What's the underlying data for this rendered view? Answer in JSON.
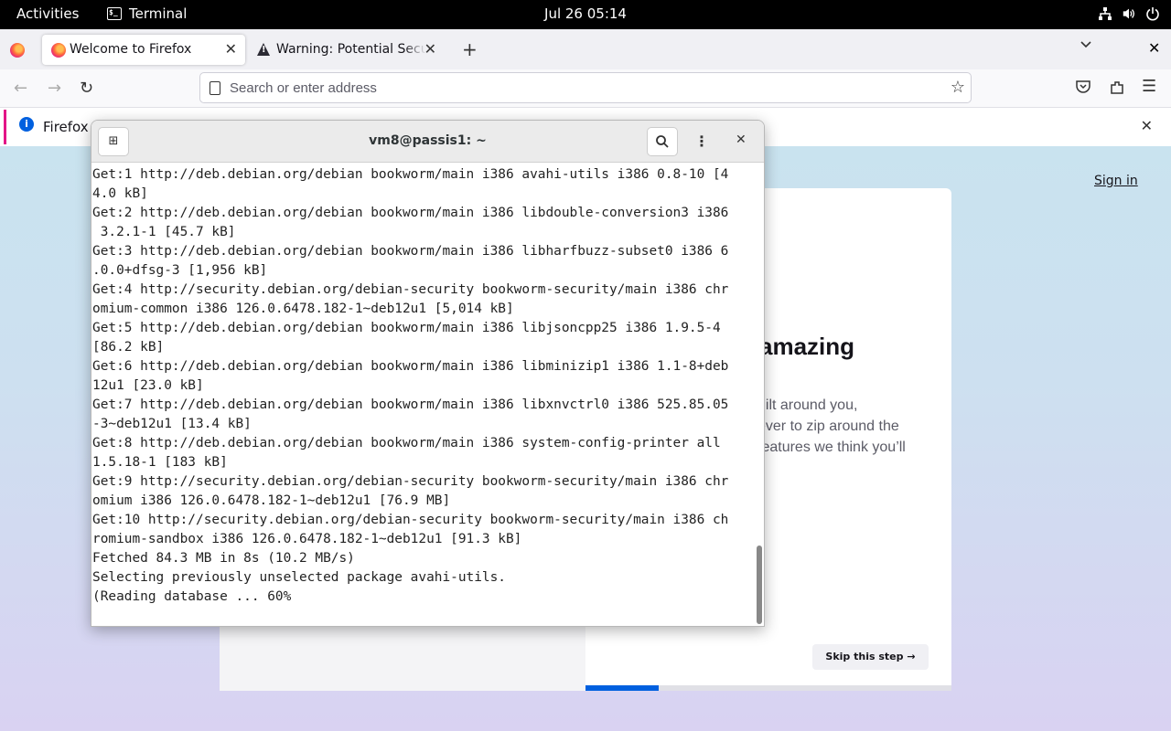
{
  "topbar": {
    "activities": "Activities",
    "app_name": "Terminal",
    "clock": "Jul 26  05:14"
  },
  "firefox": {
    "tabs": [
      {
        "title": "Welcome to Firefox",
        "active": true
      },
      {
        "title": "Warning: Potential Security Risk Ahead",
        "active": false
      }
    ],
    "address_placeholder": "Search or enter address",
    "notice_text": "Firefox a",
    "welcome": {
      "sign_in": "Sign in",
      "heading": "amazing",
      "body_lines": [
        "uilt around you,",
        "ever to zip around the",
        "features we think you’ll"
      ],
      "skip_label": "Skip this step →",
      "progress_fraction": 0.2
    }
  },
  "terminal": {
    "title": "vm8@passis1: ~",
    "lines": [
      "Get:1 http://deb.debian.org/debian bookworm/main i386 avahi-utils i386 0.8-10 [4",
      "4.0 kB]",
      "Get:2 http://deb.debian.org/debian bookworm/main i386 libdouble-conversion3 i386",
      " 3.2.1-1 [45.7 kB]",
      "Get:3 http://deb.debian.org/debian bookworm/main i386 libharfbuzz-subset0 i386 6",
      ".0.0+dfsg-3 [1,956 kB]",
      "Get:4 http://security.debian.org/debian-security bookworm-security/main i386 chr",
      "omium-common i386 126.0.6478.182-1~deb12u1 [5,014 kB]",
      "Get:5 http://deb.debian.org/debian bookworm/main i386 libjsoncpp25 i386 1.9.5-4",
      "[86.2 kB]",
      "Get:6 http://deb.debian.org/debian bookworm/main i386 libminizip1 i386 1.1-8+deb",
      "12u1 [23.0 kB]",
      "Get:7 http://deb.debian.org/debian bookworm/main i386 libxnvctrl0 i386 525.85.05",
      "-3~deb12u1 [13.4 kB]",
      "Get:8 http://deb.debian.org/debian bookworm/main i386 system-config-printer all",
      "1.5.18-1 [183 kB]",
      "Get:9 http://security.debian.org/debian-security bookworm-security/main i386 chr",
      "omium i386 126.0.6478.182-1~deb12u1 [76.9 MB]",
      "Get:10 http://security.debian.org/debian-security bookworm-security/main i386 ch",
      "romium-sandbox i386 126.0.6478.182-1~deb12u1 [91.3 kB]",
      "Fetched 84.3 MB in 8s (10.2 MB/s)",
      "Selecting previously unselected package avahi-utils.",
      "(Reading database ... 60%"
    ]
  },
  "colors": {
    "firefox_accent": "#0060df",
    "topbar_bg": "#000000",
    "terminal_bg": "#ffffff"
  },
  "icons": [
    "terminal-icon",
    "network-icon",
    "volume-icon",
    "power-icon",
    "firefox-icon",
    "warning-icon",
    "plus-icon",
    "chevron-down-icon",
    "close-icon",
    "back-arrow-icon",
    "forward-arrow-icon",
    "reload-icon",
    "page-icon",
    "star-icon",
    "pocket-icon",
    "extensions-icon",
    "hamburger-menu-icon",
    "info-icon",
    "new-tab-icon",
    "search-icon",
    "kebab-menu-icon"
  ]
}
